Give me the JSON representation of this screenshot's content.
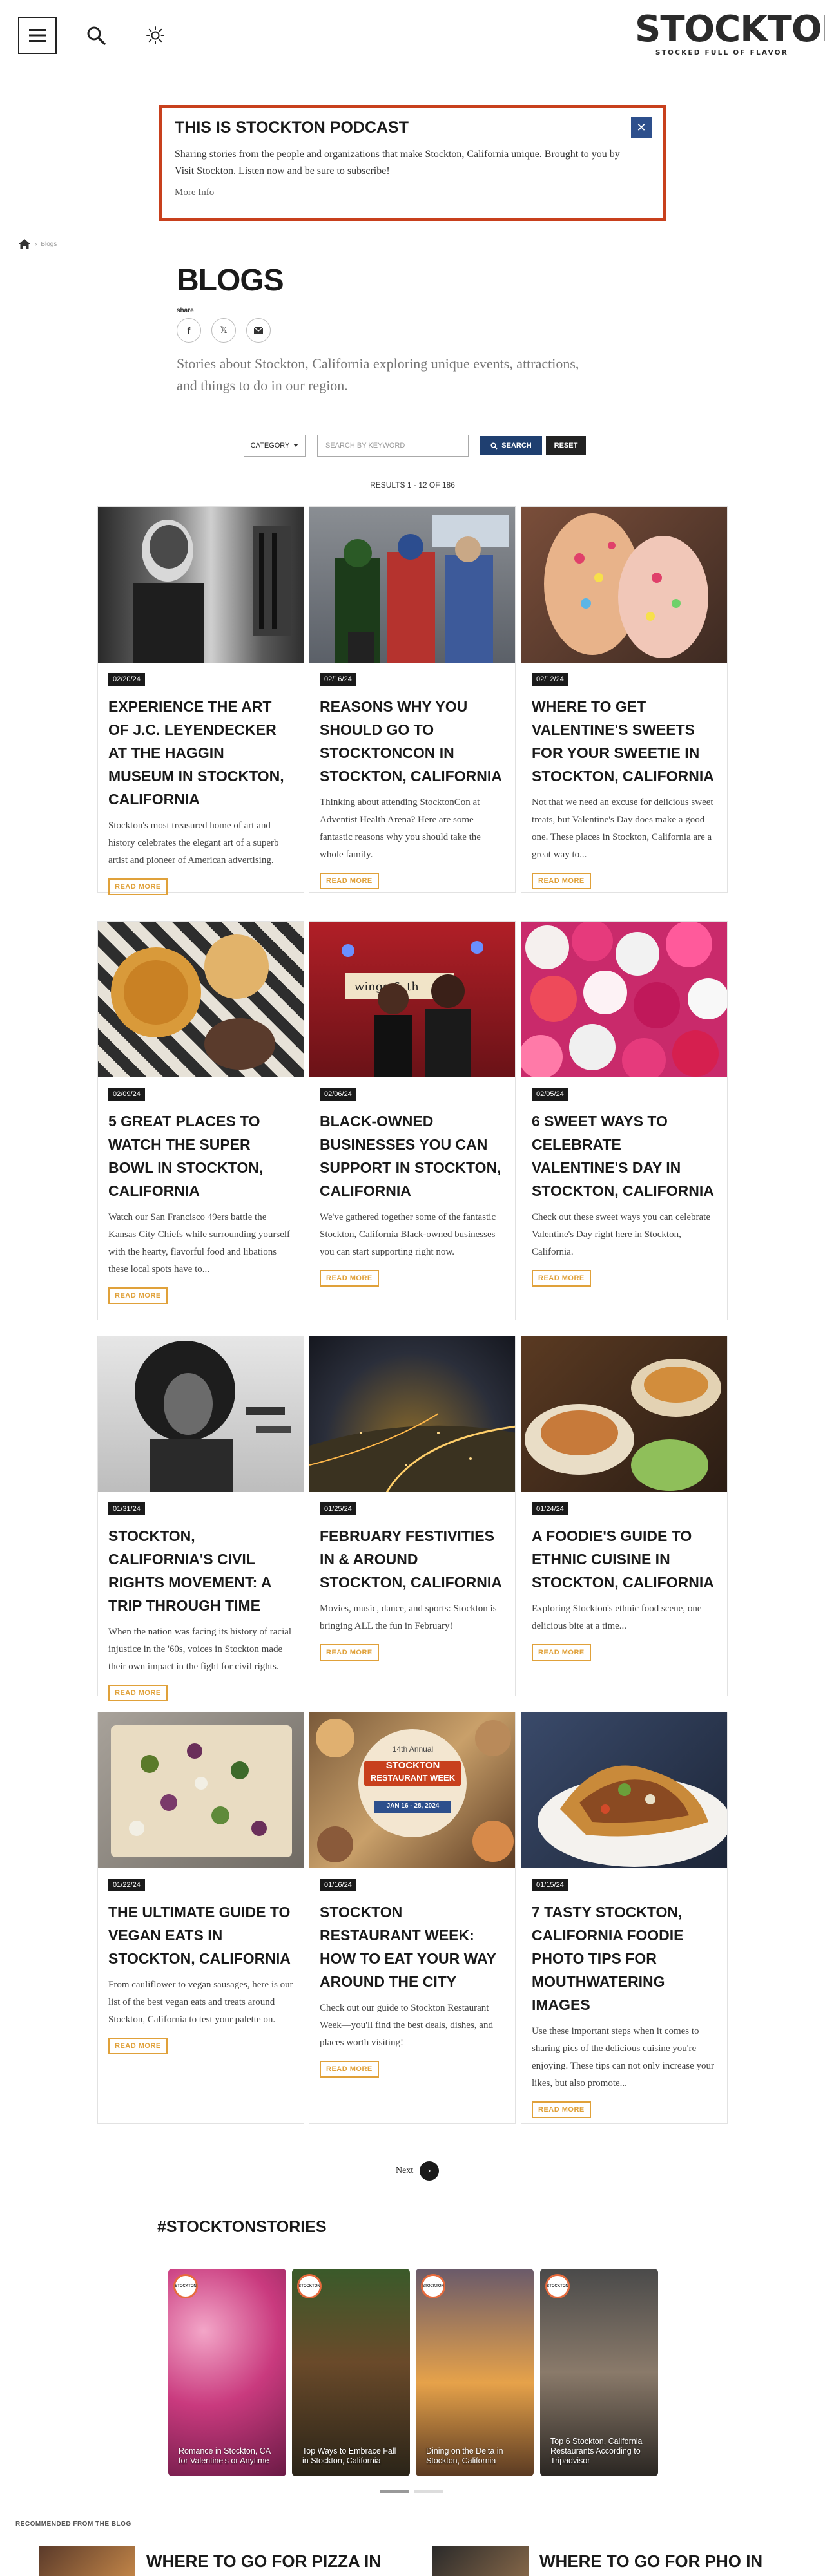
{
  "header": {
    "logo_word": "STOCKTON",
    "logo_tagline": "STOCKED FULL OF FLAVOR"
  },
  "podcast": {
    "title": "THIS IS STOCKTON PODCAST",
    "text": "Sharing stories from the people and organizations that make Stockton, California unique. Brought to you by Visit Stockton. Listen now and be sure to subscribe!",
    "more": "More Info",
    "close": "✕"
  },
  "breadcrumb": {
    "current": "Blogs"
  },
  "page": {
    "title": "BLOGS",
    "share_label": "share",
    "intro": "Stories about Stockton, California exploring unique events, attractions, and things to do in our region."
  },
  "filter": {
    "category_label": "CATEGORY",
    "search_placeholder": "SEARCH BY KEYWORD",
    "search_btn": "SEARCH",
    "reset_btn": "RESET"
  },
  "results_text": "RESULTS 1 - 12 OF 186",
  "read_more": "READ MORE",
  "cards": [
    {
      "date": "02/20/24",
      "title": "EXPERIENCE THE ART OF J.C. LEYENDECKER AT THE HAGGIN MUSEUM IN STOCKTON, CALIFORNIA",
      "desc": "Stockton's most treasured home of art and history celebrates the elegant art of a superb artist and pioneer of American advertising."
    },
    {
      "date": "02/16/24",
      "title": "REASONS WHY YOU SHOULD GO TO STOCKTONCON IN STOCKTON, CALIFORNIA",
      "desc": "Thinking about attending StocktonCon at Adventist Health Arena? Here are some fantastic reasons why you should take the whole family."
    },
    {
      "date": "02/12/24",
      "title": "WHERE TO GET VALENTINE'S SWEETS FOR YOUR SWEETIE IN STOCKTON, CALIFORNIA",
      "desc": "Not that we need an excuse for delicious sweet treats, but Valentine's Day does make a good one. These places in Stockton, California are a great way to..."
    },
    {
      "date": "02/09/24",
      "title": "5 GREAT PLACES TO WATCH THE SUPER BOWL IN STOCKTON, CALIFORNIA",
      "desc": "Watch our San Francisco 49ers battle the Kansas City Chiefs while surrounding yourself with the hearty, flavorful food and libations these local spots have to..."
    },
    {
      "date": "02/06/24",
      "title": "BLACK-OWNED BUSINESSES YOU CAN SUPPORT IN STOCKTON, CALIFORNIA",
      "desc": "We've gathered together some of the fantastic Stockton, California Black-owned businesses you can start supporting right now."
    },
    {
      "date": "02/05/24",
      "title": "6 SWEET WAYS TO CELEBRATE VALENTINE'S DAY IN STOCKTON, CALIFORNIA",
      "desc": "Check out these sweet ways you can celebrate Valentine's Day right here in Stockton, California."
    },
    {
      "date": "01/31/24",
      "title": "STOCKTON, CALIFORNIA'S CIVIL RIGHTS MOVEMENT: A TRIP THROUGH TIME",
      "desc": "When the nation was facing its history of racial injustice in the '60s, voices in Stockton made their own impact in the fight for civil rights."
    },
    {
      "date": "01/25/24",
      "title": "FEBRUARY FESTIVITIES IN & AROUND STOCKTON, CALIFORNIA",
      "desc": "Movies, music, dance, and sports: Stockton is bringing ALL the fun in February!"
    },
    {
      "date": "01/24/24",
      "title": "A FOODIE'S GUIDE TO ETHNIC CUISINE IN STOCKTON, CALIFORNIA",
      "desc": "Exploring Stockton's ethnic food scene, one delicious bite at a time..."
    },
    {
      "date": "01/22/24",
      "title": "THE ULTIMATE GUIDE TO VEGAN EATS IN STOCKTON, CALIFORNIA",
      "desc": "From cauliflower to vegan sausages, here is our list of the best vegan eats and treats around Stockton, California to test your palette on."
    },
    {
      "date": "01/16/24",
      "title": "STOCKTON RESTAURANT WEEK: HOW TO EAT YOUR WAY AROUND THE CITY",
      "desc": "Check out our guide to Stockton Restaurant Week—you'll find the best deals, dishes, and places worth visiting!"
    },
    {
      "date": "01/15/24",
      "title": "7 TASTY STOCKTON, CALIFORNIA FOODIE PHOTO TIPS FOR MOUTHWATERING IMAGES",
      "desc": "Use these important steps when it comes to sharing pics of the delicious cuisine you're enjoying. These tips can not only increase your likes, but also promote..."
    }
  ],
  "restaurant_week_img": {
    "line1": "14th Annual",
    "line2": "STOCKTON",
    "line3": "RESTAURANT WEEK",
    "dates": "JAN 16 - 28, 2024"
  },
  "pager": {
    "next": "Next"
  },
  "stories": {
    "title": "#STOCKTONSTORIES",
    "badge": "STOCKTON",
    "items": [
      {
        "caption": "Romance in Stockton, CA for Valentine's or Anytime"
      },
      {
        "caption": "Top Ways to Embrace Fall in Stockton, California"
      },
      {
        "caption": "Dining on the Delta in Stockton, California"
      },
      {
        "caption": "Top 6 Stockton, California Restaurants According to Tripadvisor"
      }
    ]
  },
  "recommended": {
    "label": "RECOMMENDED FROM THE BLOG",
    "items": [
      {
        "title": "WHERE TO GO FOR PIZZA IN"
      },
      {
        "title": "WHERE TO GO FOR PHO IN"
      }
    ]
  },
  "colors": {
    "accent_orange": "#c8401d",
    "read_more": "#e0a13a",
    "search_blue": "#1f3f70"
  }
}
